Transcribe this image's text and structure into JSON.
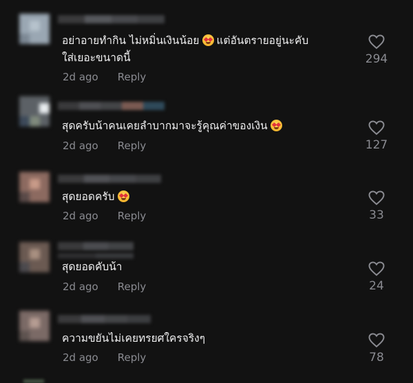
{
  "comments": [
    {
      "text": "อย่าอายทำกิน ไม่หมิ่นเงินน้อย",
      "text_after": "แต่อันตรายอยู่นะคับ",
      "text_line2": "ใส่เยอะขนาดนี้",
      "time": "2d ago",
      "reply": "Reply",
      "likes": "294",
      "emoji": "star-struck-emoji"
    },
    {
      "text": "สุดครับน้าคนเคยลำบากมาจะรู้คุณค่าของเงิน",
      "time": "2d ago",
      "reply": "Reply",
      "likes": "127",
      "emoji": "star-struck-emoji"
    },
    {
      "text": "สุดยอดครับ",
      "time": "2d ago",
      "reply": "Reply",
      "likes": "33",
      "emoji": "star-struck-emoji"
    },
    {
      "text": "สุดยอดคับน้า",
      "time": "2d ago",
      "reply": "Reply",
      "likes": "24"
    },
    {
      "text": "ความขยันไม่เคยทรยศใครจริงๆ",
      "time": "2d ago",
      "reply": "Reply",
      "likes": "78"
    }
  ],
  "colors": {
    "background": "#121212",
    "text": "#efeff0",
    "meta": "#8a8b91"
  }
}
